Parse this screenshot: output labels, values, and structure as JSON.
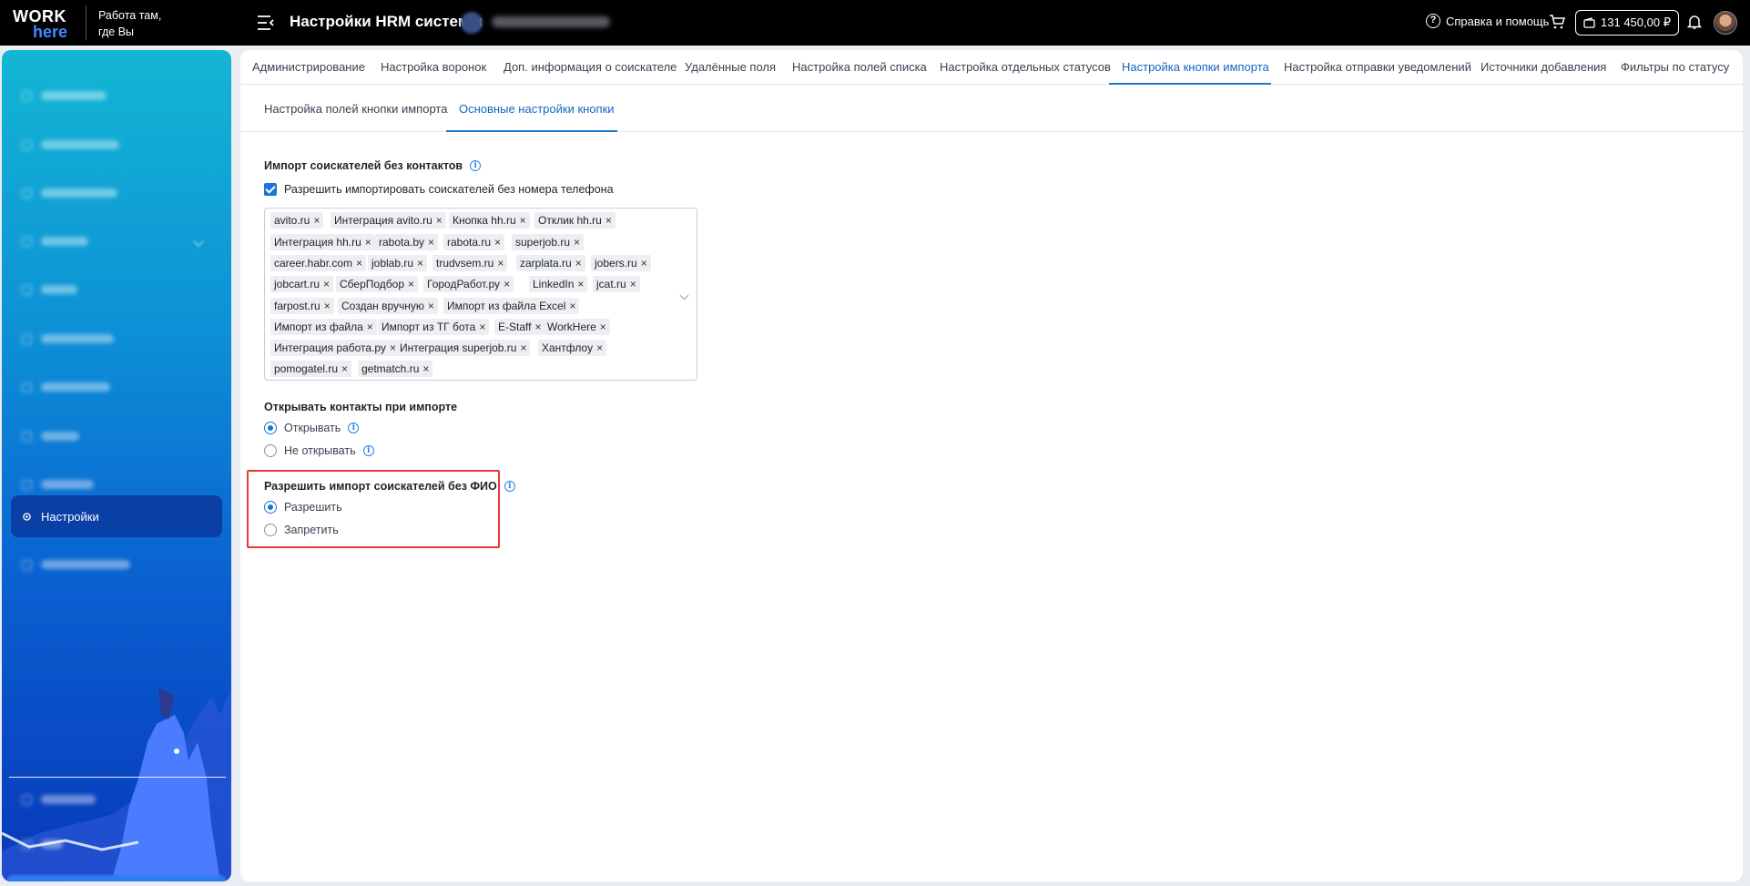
{
  "header": {
    "logo_top": "WORK",
    "logo_bottom": "here",
    "slogan": "Работа там, где Вы",
    "title": "Настройки HRM системы",
    "help_label": "Справка и помощь",
    "balance": "131 450,00 ₽"
  },
  "sidebar": {
    "active_label": "Настройки"
  },
  "tabs": [
    "Администрирование",
    "Настройка воронок",
    "Доп. информация о соискателе",
    "Удалённые поля",
    "Настройка полей списка",
    "Настройка отдельных статусов",
    "Настройка кнопки импорта",
    "Настройка отправки уведомлений",
    "Источники добавления",
    "Фильтры по статусу"
  ],
  "active_tab": "Настройка кнопки импорта",
  "subtabs": [
    "Настройка полей кнопки импорта",
    "Основные настройки кнопки"
  ],
  "active_subtab": "Основные настройки кнопки",
  "import_without_contacts": {
    "title": "Импорт соискателей без контактов",
    "checkbox_label": "Разрешить импортировать соискателей без номера телефона",
    "checked": true,
    "sources": [
      [
        "avito.ru",
        "Интеграция avito.ru",
        "Кнопка hh.ru",
        "Отклик hh.ru"
      ],
      [
        "Интеграция hh.ru",
        "rabota.by",
        "rabota.ru",
        "superjob.ru"
      ],
      [
        "career.habr.com",
        "joblab.ru",
        "trudvsem.ru",
        "zarplata.ru",
        "jobers.ru"
      ],
      [
        "jobcart.ru",
        "СберПодбор",
        "ГородРабот.ру",
        "LinkedIn",
        "jcat.ru"
      ],
      [
        "farpost.ru",
        "Создан вручную",
        "Импорт из файла Excel"
      ],
      [
        "Импорт из файла",
        "Импорт из ТГ бота",
        "E-Staff",
        "WorkHere"
      ],
      [
        "Интеграция работа.ру",
        "Интеграция superjob.ru",
        "Хантфлоу"
      ],
      [
        "pomogatel.ru",
        "getmatch.ru"
      ]
    ]
  },
  "open_contacts": {
    "title": "Открывать контакты при импорте",
    "options": [
      "Открывать",
      "Не открывать"
    ],
    "selected": "Открывать"
  },
  "allow_without_name": {
    "title": "Разрешить импорт соискателей без ФИО",
    "options": [
      "Разрешить",
      "Запретить"
    ],
    "selected": "Разрешить"
  },
  "colors": {
    "accent": "#1976d2",
    "highlight": "#e53935",
    "sidebar_top": "#13b6d4",
    "sidebar_bottom": "#0838b8"
  }
}
